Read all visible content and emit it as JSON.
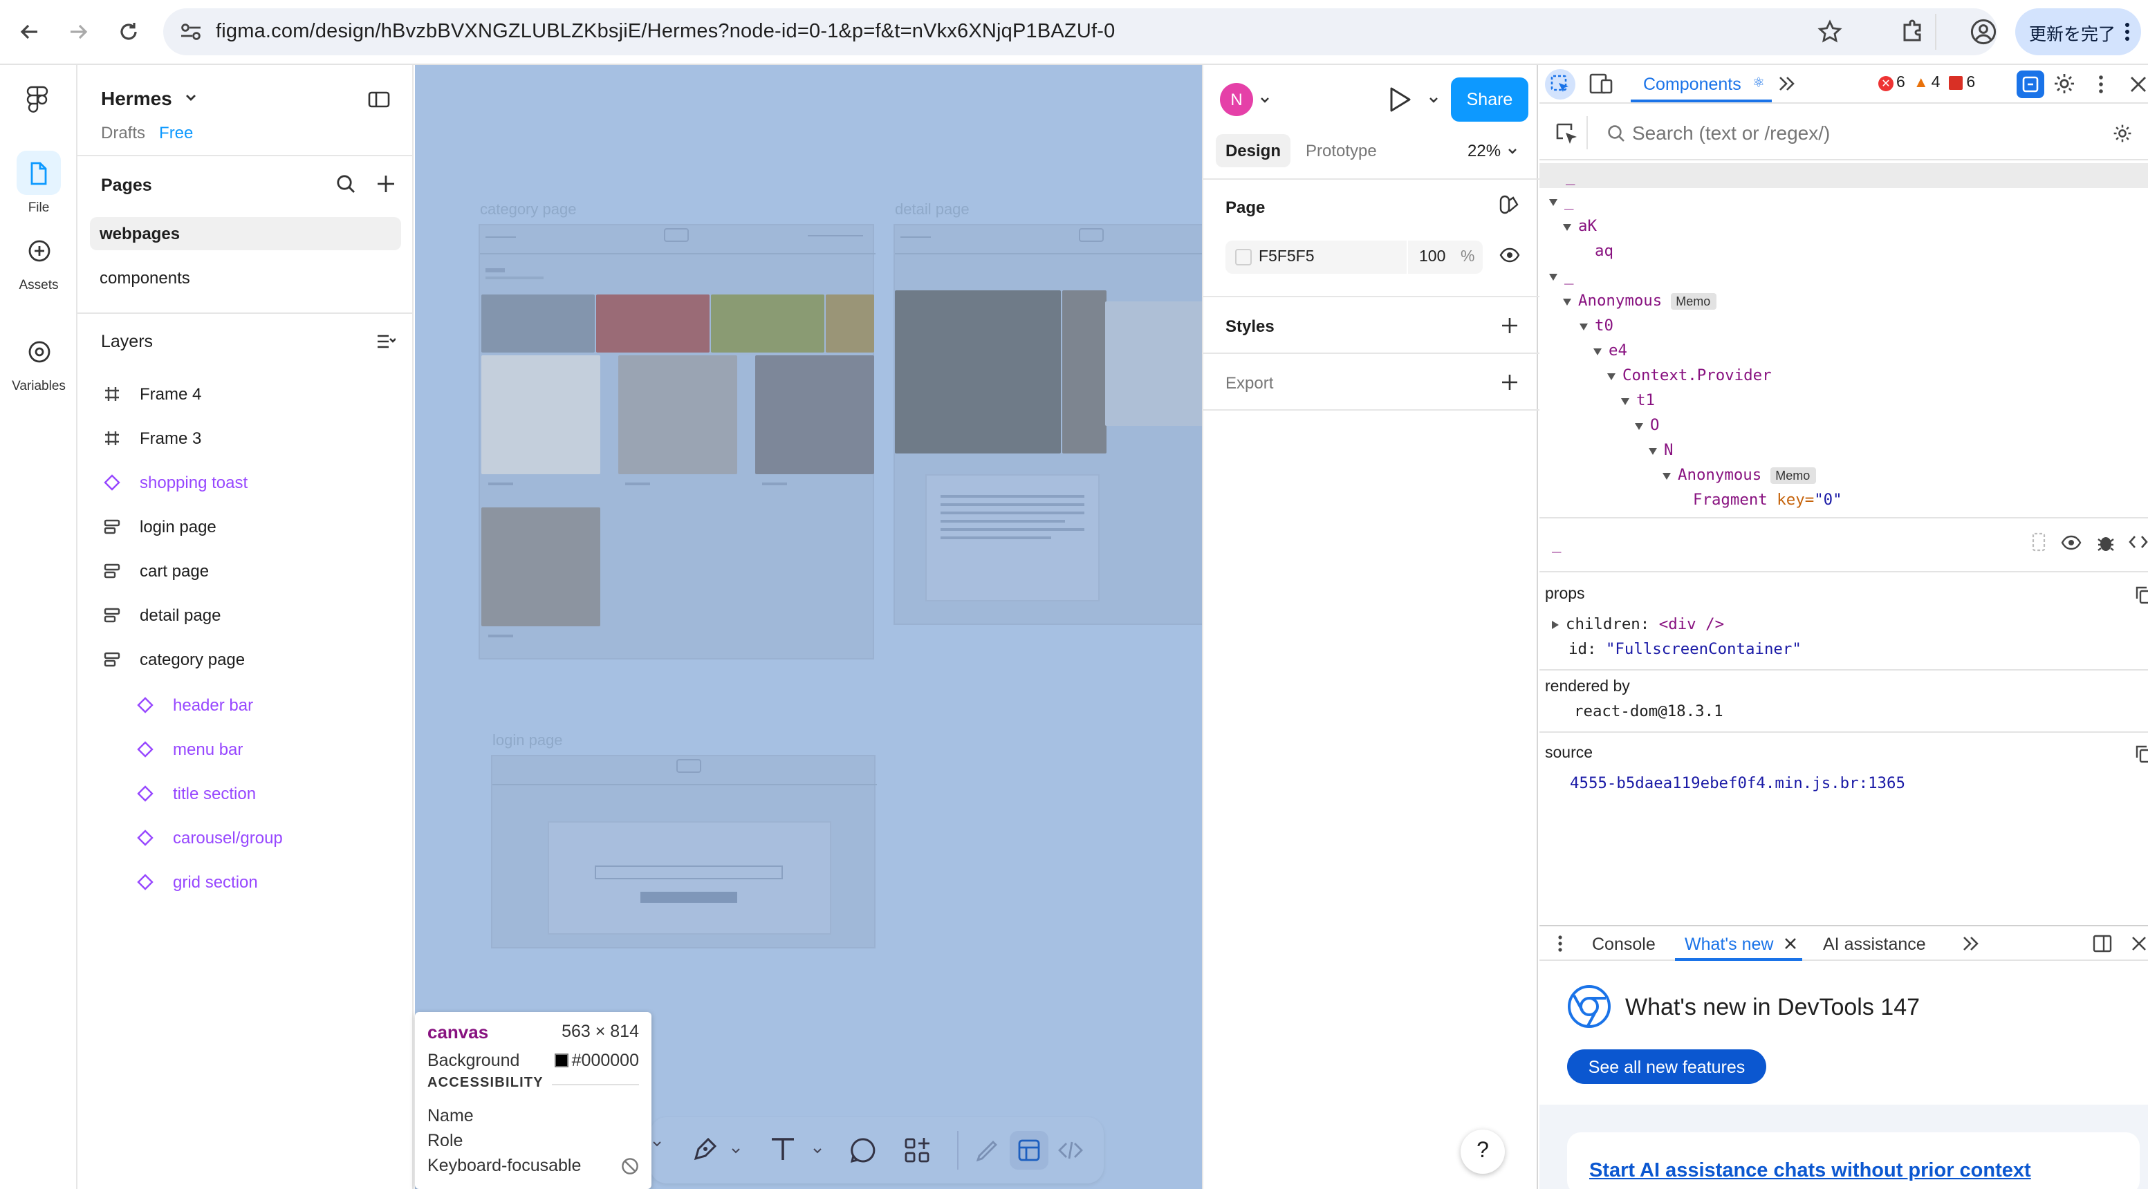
{
  "browser": {
    "url": "figma.com/design/hBvzbBVXNGZLUBLZKbsjiE/Hermes?node-id=0-1&p=f&t=nVkx6XNjqP1BAZUf-0",
    "update_label": "更新を完了"
  },
  "rail": {
    "file_label": "File",
    "assets_label": "Assets",
    "variables_label": "Variables"
  },
  "file": {
    "name": "Hermes",
    "drafts_label": "Drafts",
    "plan_label": "Free"
  },
  "pages": {
    "title": "Pages",
    "items": [
      {
        "label": "webpages"
      },
      {
        "label": "components"
      }
    ]
  },
  "layers": {
    "title": "Layers",
    "items": [
      {
        "label": "Frame 4",
        "icon": "frame-icon"
      },
      {
        "label": "Frame 3",
        "icon": "frame-icon"
      },
      {
        "label": "shopping toast",
        "icon": "component-instance-icon"
      },
      {
        "label": "login page",
        "icon": "auto-layout-icon"
      },
      {
        "label": "cart page",
        "icon": "auto-layout-icon"
      },
      {
        "label": "detail page",
        "icon": "auto-layout-icon"
      },
      {
        "label": "category page",
        "icon": "auto-layout-icon"
      },
      {
        "label": "header bar",
        "icon": "component-instance-icon"
      },
      {
        "label": "menu bar",
        "icon": "component-instance-icon"
      },
      {
        "label": "title section",
        "icon": "component-instance-icon"
      },
      {
        "label": "carousel/group",
        "icon": "component-instance-icon"
      },
      {
        "label": "grid section",
        "icon": "component-instance-icon"
      }
    ]
  },
  "canvas": {
    "frame_labels": {
      "category": "category page",
      "detail": "detail page",
      "login": "login page"
    }
  },
  "tooltip": {
    "title": "canvas",
    "size": "563 × 814",
    "background_label": "Background",
    "background_value": "#000000",
    "section": "ACCESSIBILITY",
    "name_label": "Name",
    "role_label": "Role",
    "focusable_label": "Keyboard-focusable"
  },
  "design": {
    "avatar_letter": "N",
    "share_label": "Share",
    "tab_design": "Design",
    "tab_prototype": "Prototype",
    "zoom": "22%",
    "page_title": "Page",
    "bg_hex": "F5F5F5",
    "bg_opacity": "100",
    "percent": "%",
    "styles_title": "Styles",
    "export_title": "Export"
  },
  "devtools": {
    "tab_components": "Components",
    "errors": "6",
    "warnings": "4",
    "issues": "6",
    "search_placeholder": "Search (text or /regex/)",
    "tree": {
      "l0": "_",
      "l1": "_",
      "l2": "aK",
      "l3": "aq",
      "l4": "_",
      "l5": "Anonymous",
      "memo": "Memo",
      "l6": "t0",
      "l7": "e4",
      "l8": "Context.Provider",
      "l9": "t1",
      "l10": "O",
      "l11": "N",
      "l12": "Anonymous",
      "l13": "Fragment",
      "l13_key": "key=",
      "l13_val": "\"0\""
    },
    "selected": "_",
    "props_title": "props",
    "prop_children_key": "children:",
    "prop_children_val": "<div />",
    "prop_id_key": "id:",
    "prop_id_val": "\"FullscreenContainer\"",
    "rendered_by_title": "rendered by",
    "rendered_by_val": "react-dom@18.3.1",
    "source_title": "source",
    "source_val": "4555-b5daea119ebef0f4.min.js.br:1365",
    "drawer_tabs": {
      "console": "Console",
      "whats_new": "What's new",
      "ai": "AI assistance"
    },
    "whats_new_heading": "What's new in DevTools 147",
    "see_all_label": "See all new features",
    "ai_link": "Start AI assistance chats without prior context"
  },
  "colors": {
    "figma_blue": "#0d99ff",
    "canvas_bg": "#a6c0e2",
    "component_purple": "#9747ff",
    "devtools_blue": "#1a73e8"
  }
}
